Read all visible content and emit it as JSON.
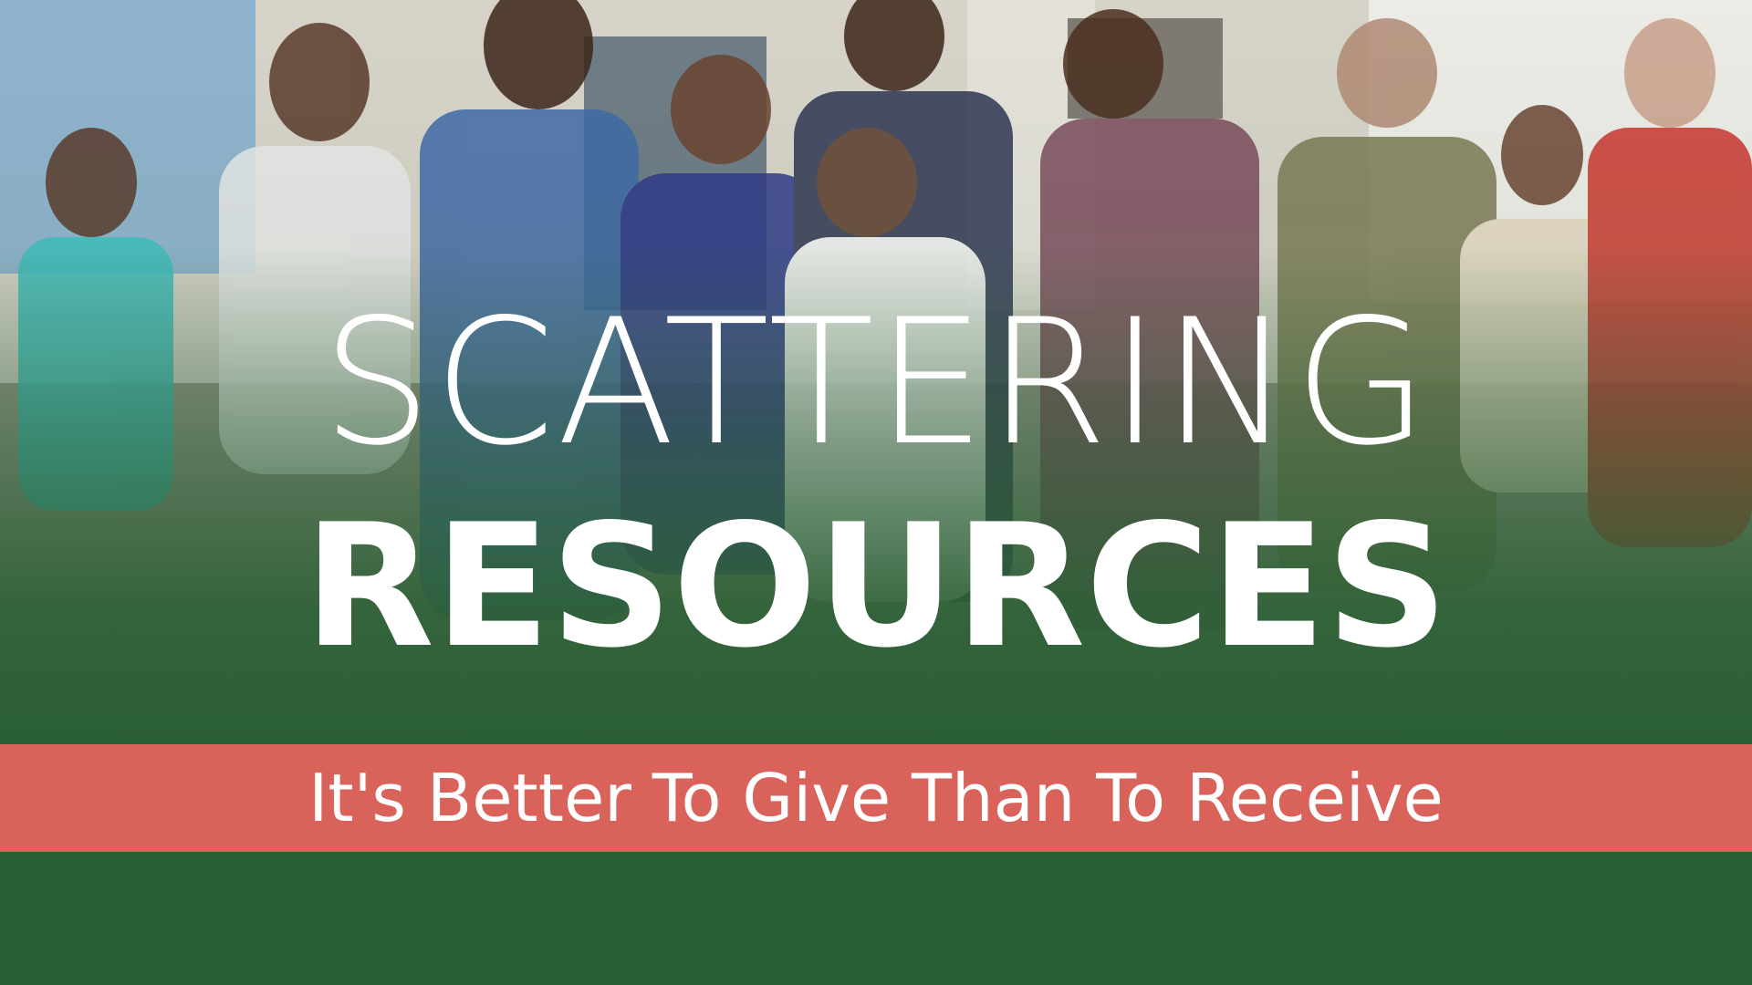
{
  "banner": {
    "title_line1": "SCATTERING",
    "title_line2": "RESOURCES",
    "tagline": "It's Better To Give Than To Receive"
  },
  "colors": {
    "green": "#2b5f34",
    "tagline_bar": "#d9625a",
    "text": "#ffffff"
  }
}
